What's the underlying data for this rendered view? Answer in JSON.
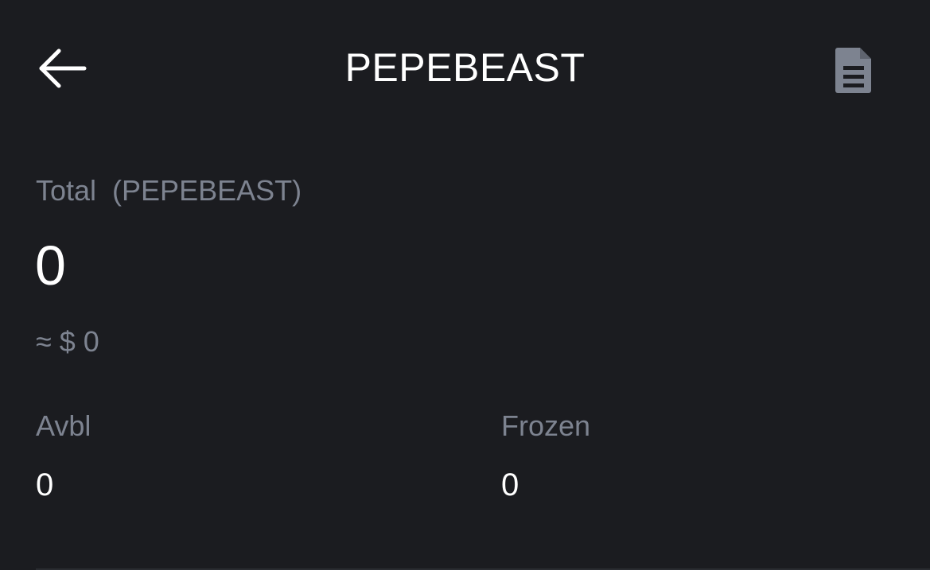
{
  "header": {
    "title": "PEPEBEAST",
    "back_icon": "arrow-left-icon",
    "records_icon": "document-icon"
  },
  "total": {
    "label": "Total  (PEPEBEAST)",
    "value": "0",
    "fiat_value": "≈ $ 0"
  },
  "balances": {
    "available_label": "Avbl",
    "available_value": "0",
    "frozen_label": "Frozen",
    "frozen_value": "0"
  },
  "colors": {
    "background": "#1b1c20",
    "primary_text": "#ffffff",
    "secondary_text": "#7d8390",
    "icon_gray": "#7d8390"
  }
}
